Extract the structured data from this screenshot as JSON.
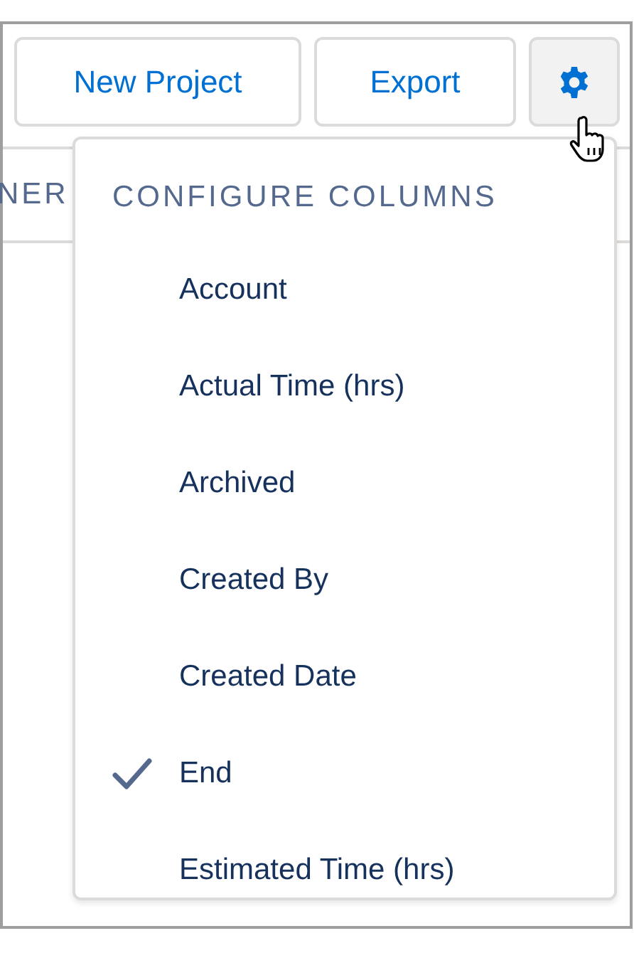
{
  "buttons": [
    "New Project",
    "Export"
  ],
  "settings_button": {
    "expanded": true
  },
  "table": {
    "columns": [
      {
        "label": "NER"
      }
    ]
  },
  "menu": {
    "title": "CONFIGURE COLUMNS",
    "items": [
      {
        "label": "Account",
        "checked": false
      },
      {
        "label": "Actual Time (hrs)",
        "checked": false
      },
      {
        "label": "Archived",
        "checked": false
      },
      {
        "label": "Created By",
        "checked": false
      },
      {
        "label": "Created Date",
        "checked": false
      },
      {
        "label": "End",
        "checked": true
      },
      {
        "label": "Estimated Time (hrs)",
        "checked": false
      }
    ]
  }
}
